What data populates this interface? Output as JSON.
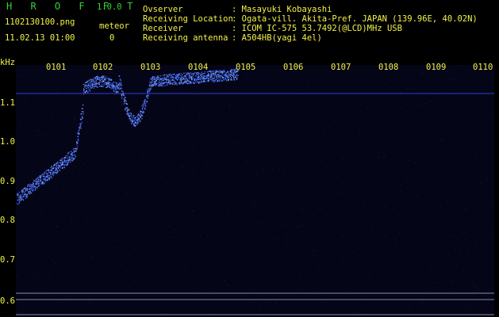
{
  "header": {
    "app_title": "H R O F F T",
    "version": "1.0.0",
    "filename": "1102130100.png",
    "mode": "meteor",
    "datetime": "11.02.13 01:00",
    "count": "0",
    "info": [
      {
        "label": "Ovserver",
        "value": ": Masayuki Kobayashi"
      },
      {
        "label": "Receiving Location",
        "value": ": Ogata-vill. Akita-Pref. JAPAN (139.96E, 40.02N)"
      },
      {
        "label": "Receiver",
        "value": ": ICOM IC-575 53.7492(@LCD)MHz USB"
      },
      {
        "label": "Receiving antenna",
        "value": ": A504HB(yagi 4el)"
      }
    ]
  },
  "axis": {
    "unit": "kHz",
    "y_ticks": [
      "1.1",
      "1.0",
      "0.9",
      "0.8",
      "0.7",
      "0.6"
    ],
    "time_ticks": [
      "0101",
      "0102",
      "0103",
      "0104",
      "0105",
      "0106",
      "0107",
      "0108",
      "0109",
      "0110"
    ]
  },
  "colors": {
    "background": "#000000",
    "plot_background": "#050518",
    "text_yellow": "#f2f24a",
    "title_green": "#36d236",
    "signal_blue": "#3f6bff",
    "reference_line": "#2a3fd6",
    "lower_lines": "#8a8aa8"
  }
}
